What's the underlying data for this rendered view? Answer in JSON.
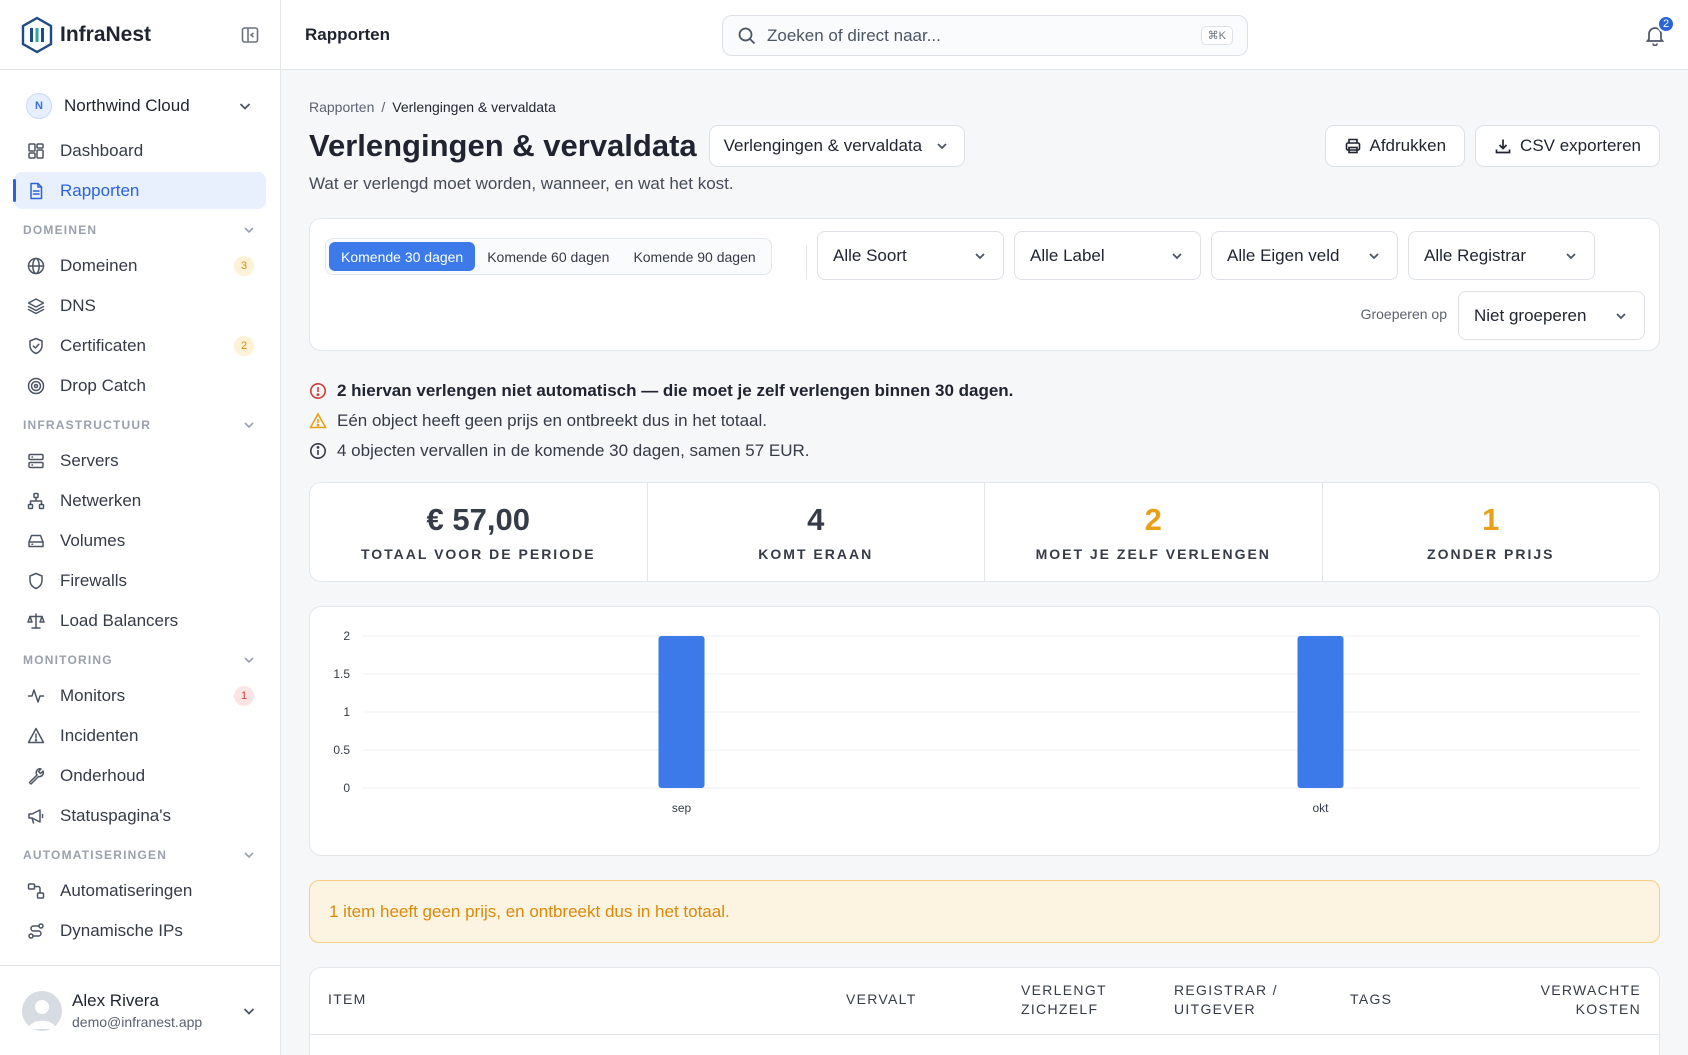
{
  "app": {
    "name": "InfraNest"
  },
  "org": {
    "initial": "N",
    "name": "Northwind Cloud"
  },
  "nav": {
    "top": [
      {
        "label": "Dashboard",
        "icon": "dashboard-icon"
      },
      {
        "label": "Rapporten",
        "icon": "report-icon",
        "active": true
      }
    ],
    "sections": [
      {
        "title": "DOMEINEN",
        "items": [
          {
            "label": "Domeinen",
            "icon": "globe-icon",
            "badge": "3",
            "badge_color": "amber"
          },
          {
            "label": "DNS",
            "icon": "layers-icon"
          },
          {
            "label": "Certificaten",
            "icon": "shield-check-icon",
            "badge": "2",
            "badge_color": "amber"
          },
          {
            "label": "Drop Catch",
            "icon": "target-icon"
          }
        ]
      },
      {
        "title": "INFRASTRUCTUUR",
        "items": [
          {
            "label": "Servers",
            "icon": "server-icon"
          },
          {
            "label": "Netwerken",
            "icon": "network-icon"
          },
          {
            "label": "Volumes",
            "icon": "drive-icon"
          },
          {
            "label": "Firewalls",
            "icon": "shield-icon"
          },
          {
            "label": "Load Balancers",
            "icon": "scale-icon"
          }
        ]
      },
      {
        "title": "MONITORING",
        "items": [
          {
            "label": "Monitors",
            "icon": "activity-icon",
            "badge": "1",
            "badge_color": "red"
          },
          {
            "label": "Incidenten",
            "icon": "alert-triangle-icon"
          },
          {
            "label": "Onderhoud",
            "icon": "wrench-icon"
          },
          {
            "label": "Statuspagina's",
            "icon": "megaphone-icon"
          }
        ]
      },
      {
        "title": "AUTOMATISERINGEN",
        "items": [
          {
            "label": "Automatiseringen",
            "icon": "workflow-icon"
          },
          {
            "label": "Dynamische IPs",
            "icon": "route-icon"
          }
        ]
      }
    ]
  },
  "user": {
    "name": "Alex Rivera",
    "email": "demo@infranest.app"
  },
  "topbar": {
    "title": "Rapporten",
    "search_placeholder": "Zoeken of direct naar...",
    "shortcut": "⌘K",
    "notifications": "2"
  },
  "page": {
    "breadcrumb": [
      "Rapporten",
      "Verlengingen & vervaldata"
    ],
    "title": "Verlengingen & vervaldata",
    "view_select": "Verlengingen & vervaldata",
    "subtitle": "Wat er verlengd moet worden, wanneer, en wat het kost.",
    "print_label": "Afdrukken",
    "export_label": "CSV exporteren"
  },
  "filters": {
    "ranges": [
      "Komende 30 dagen",
      "Komende 60 dagen",
      "Komende 90 dagen"
    ],
    "selected_range": "Komende 30 dagen",
    "selects": [
      "Alle Soort",
      "Alle Label",
      "Alle Eigen veld",
      "Alle Registrar"
    ],
    "group_label": "Groeperen op",
    "group_value": "Niet groeperen"
  },
  "notices": [
    {
      "text": "2 hiervan verlengen niet automatisch — die moet je zelf verlengen binnen 30 dagen.",
      "level": "error",
      "color": "#d33b3b"
    },
    {
      "text": "Eén object heeft geen prijs en ontbreekt dus in het totaal.",
      "level": "warning",
      "color": "#e8a019"
    },
    {
      "text": "4 objecten vervallen in de komende 30 dagen, samen 57 EUR.",
      "level": "info",
      "color": "#353b47"
    }
  ],
  "stats": [
    {
      "value": "€ 57,00",
      "label": "TOTAAL VOOR DE PERIODE"
    },
    {
      "value": "4",
      "label": "KOMT ERAAN"
    },
    {
      "value": "2",
      "label": "MOET JE ZELF VERLENGEN",
      "accent": true
    },
    {
      "value": "1",
      "label": "ZONDER PRIJS",
      "accent": true
    }
  ],
  "chart_data": {
    "type": "bar",
    "categories": [
      "sep",
      "okt"
    ],
    "values": [
      2,
      2
    ],
    "ylim": [
      0,
      2
    ],
    "yticks": [
      "0",
      "0.5",
      "1",
      "1.5",
      "2"
    ],
    "grid": true,
    "color": "#3b7ae8"
  },
  "warning_banner": "1 item heeft geen prijs, en ontbreekt dus in het totaal.",
  "table": {
    "columns": [
      {
        "label": "ITEM"
      },
      {
        "label": "VERVALT"
      },
      {
        "label": "VERLENGT\nZICHZELF"
      },
      {
        "label": "REGISTRAR /\nUITGEVER"
      },
      {
        "label": "TAGS"
      },
      {
        "label": "VERWACHTE\nKOSTEN"
      }
    ]
  },
  "colors": {
    "accent": "#2c63d6",
    "bar": "#3b7ae8",
    "amber": "#e8a019",
    "red": "#d33b3b"
  }
}
